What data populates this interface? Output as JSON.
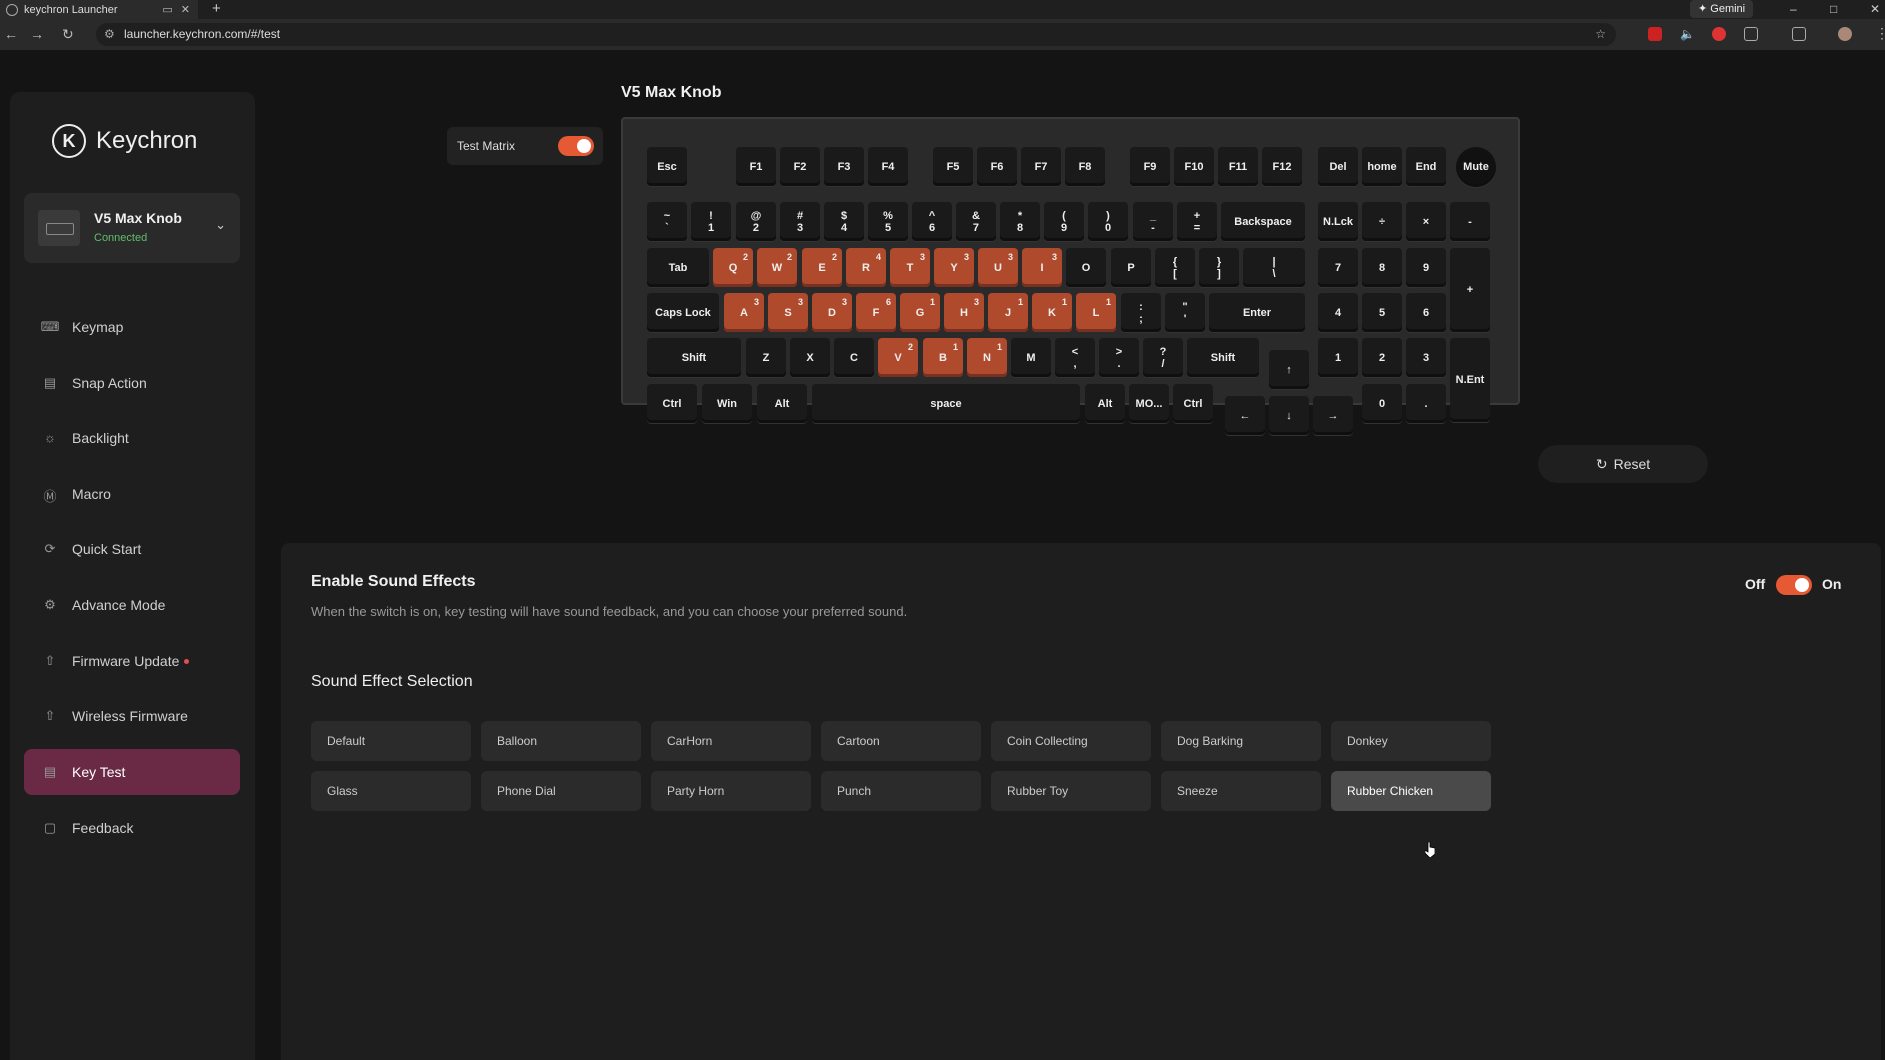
{
  "browser": {
    "tab_title": "keychron Launcher",
    "new_tab": "+",
    "url": "launcher.keychron.com/#/test",
    "gemini": "Gemini",
    "window_controls": [
      "–",
      "□",
      "✕"
    ]
  },
  "sidebar": {
    "logo_text": "Keychron",
    "device": {
      "name": "V5 Max Knob",
      "status": "Connected"
    },
    "items": [
      {
        "label": "Keymap",
        "icon": "keyboard-icon"
      },
      {
        "label": "Snap Action",
        "icon": "snap-icon"
      },
      {
        "label": "Backlight",
        "icon": "light-icon"
      },
      {
        "label": "Macro",
        "icon": "macro-icon"
      },
      {
        "label": "Quick Start",
        "icon": "rocket-icon"
      },
      {
        "label": "Advance Mode",
        "icon": "gear-icon"
      },
      {
        "label": "Firmware Update",
        "icon": "upload-icon"
      },
      {
        "label": "Wireless Firmware",
        "icon": "upload-icon"
      },
      {
        "label": "Key Test",
        "icon": "keytest-icon"
      },
      {
        "label": "Feedback",
        "icon": "feedback-icon"
      }
    ],
    "active": "Key Test"
  },
  "test_matrix": {
    "label": "Test Matrix",
    "on": true
  },
  "keyboard": {
    "title": "V5 Max Knob",
    "keys": [
      [
        "Esc",
        ""
      ],
      [
        "F1",
        ""
      ],
      [
        "F2",
        ""
      ],
      [
        "F3",
        ""
      ],
      [
        "F4",
        ""
      ],
      [
        "F5",
        ""
      ],
      [
        "F6",
        ""
      ],
      [
        "F7",
        ""
      ],
      [
        "F8",
        ""
      ],
      [
        "F9",
        ""
      ],
      [
        "F10",
        ""
      ],
      [
        "F11",
        ""
      ],
      [
        "F12",
        ""
      ],
      [
        "Del",
        ""
      ],
      [
        "home",
        ""
      ],
      [
        "End",
        ""
      ],
      [
        "Mute",
        ""
      ],
      [
        "~\n`",
        ""
      ],
      [
        "!\n1",
        ""
      ],
      [
        "@\n2",
        ""
      ],
      [
        "#\n3",
        ""
      ],
      [
        "$\n4",
        ""
      ],
      [
        "%\n5",
        ""
      ],
      [
        "^\n6",
        ""
      ],
      [
        "&\n7",
        ""
      ],
      [
        "*\n8",
        ""
      ],
      [
        "(\n9",
        ""
      ],
      [
        ")\n0",
        ""
      ],
      [
        "_\n-",
        ""
      ],
      [
        "+\n=",
        ""
      ],
      [
        "Backspace",
        ""
      ],
      [
        "N.Lck",
        ""
      ],
      [
        "÷",
        ""
      ],
      [
        "×",
        ""
      ],
      [
        "-",
        ""
      ],
      [
        "Tab",
        ""
      ],
      [
        "Q",
        "2"
      ],
      [
        "W",
        "2"
      ],
      [
        "E",
        "2"
      ],
      [
        "R",
        "4"
      ],
      [
        "T",
        "3"
      ],
      [
        "Y",
        "3"
      ],
      [
        "U",
        "3"
      ],
      [
        "I",
        "3"
      ],
      [
        "O",
        ""
      ],
      [
        "P",
        ""
      ],
      [
        "{\n[",
        ""
      ],
      [
        "}\n]",
        ""
      ],
      [
        "|\n\\",
        ""
      ],
      [
        "7",
        ""
      ],
      [
        "8",
        ""
      ],
      [
        "9",
        ""
      ],
      [
        "+",
        ""
      ],
      [
        "Caps Lock",
        ""
      ],
      [
        "A",
        "3"
      ],
      [
        "S",
        "3"
      ],
      [
        "D",
        "3"
      ],
      [
        "F",
        "6"
      ],
      [
        "G",
        "1"
      ],
      [
        "H",
        "3"
      ],
      [
        "J",
        "1"
      ],
      [
        "K",
        "1"
      ],
      [
        "L",
        "1"
      ],
      [
        ":\n;",
        ""
      ],
      [
        "\"\n'",
        ""
      ],
      [
        "Enter",
        ""
      ],
      [
        "4",
        ""
      ],
      [
        "5",
        ""
      ],
      [
        "6",
        ""
      ],
      [
        "Shift",
        ""
      ],
      [
        "Z",
        ""
      ],
      [
        "X",
        ""
      ],
      [
        "C",
        ""
      ],
      [
        "V",
        "2"
      ],
      [
        "B",
        "1"
      ],
      [
        "N",
        "1"
      ],
      [
        "M",
        ""
      ],
      [
        "<\n,",
        ""
      ],
      [
        ">\n.",
        ""
      ],
      [
        "?\n/",
        ""
      ],
      [
        "Shift",
        ""
      ],
      [
        "↑",
        ""
      ],
      [
        "1",
        ""
      ],
      [
        "2",
        ""
      ],
      [
        "3",
        ""
      ],
      [
        "N.Ent",
        ""
      ],
      [
        "Ctrl",
        ""
      ],
      [
        "Win",
        ""
      ],
      [
        "Alt",
        ""
      ],
      [
        "space",
        ""
      ],
      [
        "Alt",
        ""
      ],
      [
        "MO...",
        ""
      ],
      [
        "Ctrl",
        ""
      ],
      [
        "←",
        ""
      ],
      [
        "↓",
        ""
      ],
      [
        "→",
        ""
      ],
      [
        "0",
        ""
      ],
      [
        ".",
        ""
      ]
    ]
  },
  "reset_label": "Reset",
  "sound": {
    "title": "Enable Sound Effects",
    "description": "When the switch is on, key testing will have sound feedback, and you can choose your preferred sound.",
    "off_label": "Off",
    "on_label": "On",
    "selection_title": "Sound Effect Selection",
    "options": [
      "Default",
      "Balloon",
      "CarHorn",
      "Cartoon",
      "Coin Collecting",
      "Dog Barking",
      "Donkey",
      "Glass",
      "Phone Dial",
      "Party Horn",
      "Punch",
      "Rubber Toy",
      "Sneeze",
      "Rubber Chicken"
    ],
    "selected": "Rubber Chicken"
  },
  "colors": {
    "accent": "#e55a35",
    "active_nav": "#6a2a45",
    "hit_key": "#b04a2c"
  }
}
